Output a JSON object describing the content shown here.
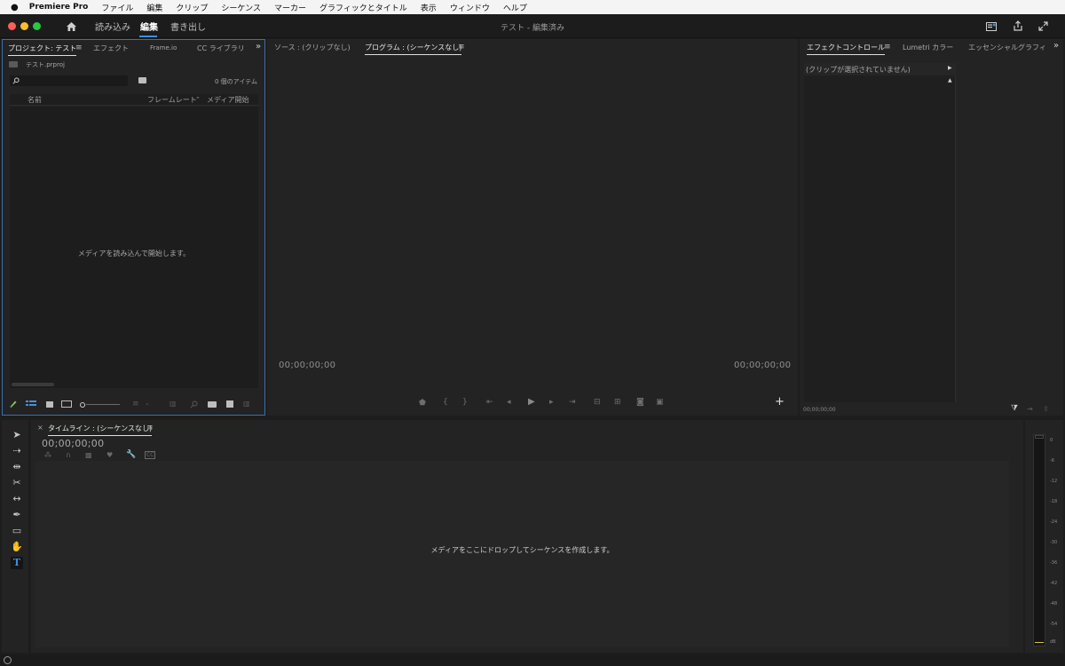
{
  "menubar": {
    "apple": "",
    "app_name": "Premiere Pro",
    "items": [
      "ファイル",
      "編集",
      "クリップ",
      "シーケンス",
      "マーカー",
      "グラフィックとタイトル",
      "表示",
      "ウィンドウ",
      "ヘルプ"
    ]
  },
  "titlebar": {
    "workspace_tabs": [
      "読み込み",
      "編集",
      "書き出し"
    ],
    "active_tab": "編集",
    "document_title": "テスト - 編集済み"
  },
  "project_panel": {
    "tabs": [
      "プロジェクト: テスト",
      "エフェクト",
      "Frame.io",
      "CC ライブラリ"
    ],
    "file_name": "テスト.prproj",
    "search_placeholder": "",
    "item_count": "0 個のアイテム",
    "columns": [
      "名前",
      "フレームレート",
      "メディア開始"
    ],
    "empty_message": "メディアを読み込んで開始します。"
  },
  "source_monitor": {
    "tab": "ソース : (クリップなし)"
  },
  "program_monitor": {
    "tab": "プログラム : (シーケンスなし)",
    "timecode_left": "00;00;00;00",
    "timecode_right": "00;00;00;00",
    "add_button": "+"
  },
  "effect_controls": {
    "tabs": [
      "エフェクトコントロール",
      "Lumetri カラー",
      "エッセンシャルグラフィ"
    ],
    "no_clip": "(クリップが選択されていません)",
    "timecode": "00;00;00;00"
  },
  "timeline": {
    "close": "×",
    "tab": "タイムライン : (シーケンスなし)",
    "timecode": "00;00;00;00",
    "empty_message": "メディアをここにドロップしてシーケンスを作成します。"
  },
  "audio_meter": {
    "ticks": [
      "0",
      "-6",
      "-12",
      "-18",
      "-24",
      "-30",
      "-36",
      "-42",
      "-48",
      "-54",
      "dB"
    ]
  },
  "colors": {
    "accent": "#3a8fe0",
    "panel_bg": "#232323",
    "app_bg": "#1d1d1d",
    "close": "#ff5f57",
    "minimize": "#febc2e",
    "zoom": "#28c840"
  }
}
